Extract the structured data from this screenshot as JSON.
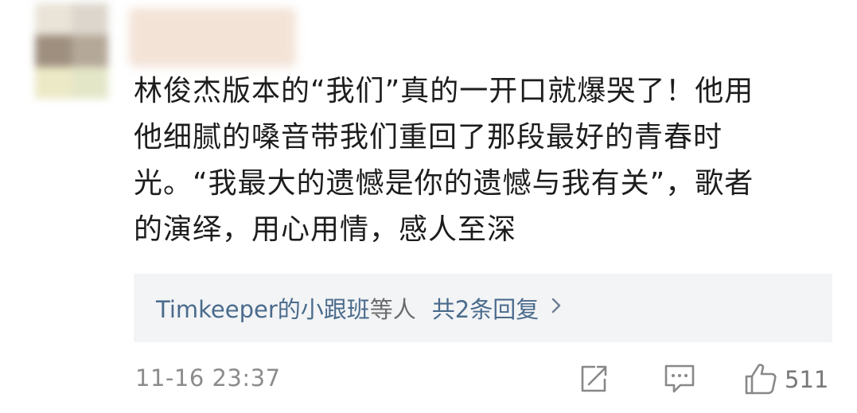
{
  "comment": {
    "line1": "林俊杰版本的“我们”真的一开口就爆哭了！他用",
    "line2": "他细腻的嗓音带我们重回了那段最好的青春时",
    "line3": "光。“我最大的遗憾是你的遗憾与我有关”，歌者",
    "line4": "的演绎，用心用情，感人至深"
  },
  "replies": {
    "user": "Timkeeper的小跟班",
    "suffix": "等人",
    "count_label": "共2条回复",
    "chevron": "›"
  },
  "footer": {
    "timestamp": "11-16 23:37",
    "like_count": "511",
    "icons": [
      "share-icon",
      "comment-icon",
      "like-icon"
    ]
  },
  "colors": {
    "link": "#4a6b8c",
    "reply_bg": "#f3f4f6",
    "meta": "#8c8c8c"
  }
}
